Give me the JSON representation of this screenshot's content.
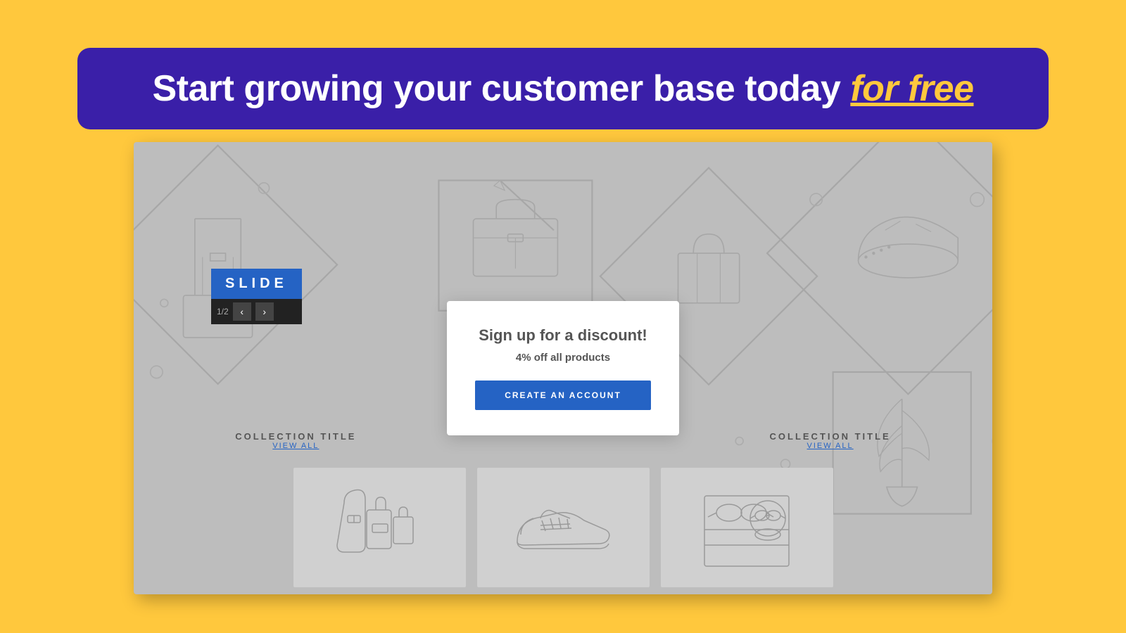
{
  "banner": {
    "text_main": "Start growing your customer base today ",
    "text_emphasis": "for free"
  },
  "preview": {
    "slide": {
      "label": "SLIDE",
      "counter": "1/2",
      "prev_btn": "‹",
      "next_btn": "›"
    },
    "collections": [
      {
        "title": "COLLECTION TITLE",
        "view_all": "VIEW ALL"
      },
      {
        "title": "COLLECTION TITLE",
        "view_all": "VIEW ALL"
      }
    ]
  },
  "popup": {
    "title": "Sign up for a discount!",
    "subtitle": "4% off all products",
    "button_label": "CREATE AN ACCOUNT"
  },
  "colors": {
    "background": "#FFC83D",
    "banner_bg": "#3A1FA8",
    "banner_text": "#FFFFFF",
    "emphasis": "#FFC83D",
    "preview_bg": "#BDBDBD",
    "button_bg": "#2563C4",
    "slide_label_bg": "#2563C4"
  }
}
